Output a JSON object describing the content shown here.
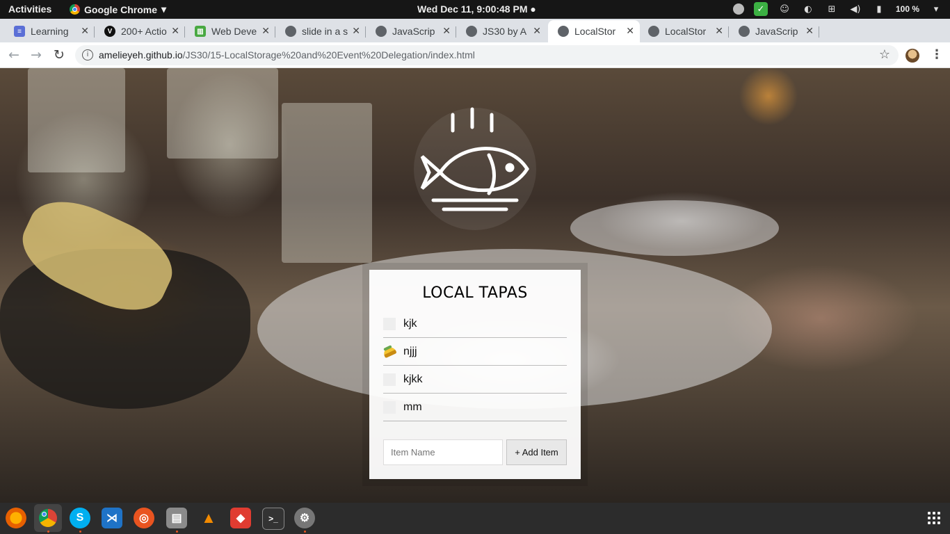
{
  "topbar": {
    "activities": "Activities",
    "app_name": "Google Chrome",
    "app_menu_icon": "caret-down-icon",
    "clock": "Wed Dec 11,  9:00:48 PM",
    "battery": "100 %"
  },
  "tabs": [
    {
      "label": "Learning",
      "favicon": "learning-icon",
      "active": false
    },
    {
      "label": "200+ Actio",
      "favicon": "v-icon",
      "active": false
    },
    {
      "label": "Web Deve",
      "favicon": "trello-icon",
      "active": false
    },
    {
      "label": "slide in a s",
      "favicon": "globe-icon",
      "active": false
    },
    {
      "label": "JavaScrip",
      "favicon": "globe-icon",
      "active": false
    },
    {
      "label": "JS30 by A",
      "favicon": "globe-icon",
      "active": false
    },
    {
      "label": "LocalStor",
      "favicon": "globe-icon",
      "active": true
    },
    {
      "label": "LocalStor",
      "favicon": "globe-icon",
      "active": false
    },
    {
      "label": "JavaScrip",
      "favicon": "globe-icon",
      "active": false
    }
  ],
  "toolbar": {
    "url_host": "amelieyeh.github.io",
    "url_path": "/JS30/15-LocalStorage%20and%20Event%20Delegation/index.html"
  },
  "app": {
    "title": "LOCAL TAPAS",
    "items": [
      {
        "text": "kjk",
        "done": false
      },
      {
        "text": "njjj",
        "done": true
      },
      {
        "text": "kjkk",
        "done": false
      },
      {
        "text": "mm",
        "done": false
      }
    ],
    "input_placeholder": "Item Name",
    "add_button": "+ Add Item"
  },
  "dock": {
    "apps": [
      "firefox-icon",
      "chrome-icon",
      "skype-icon",
      "vscode-icon",
      "ubuntu-software-icon",
      "files-icon",
      "vlc-icon",
      "git-icon",
      "terminal-icon",
      "settings-icon"
    ]
  }
}
